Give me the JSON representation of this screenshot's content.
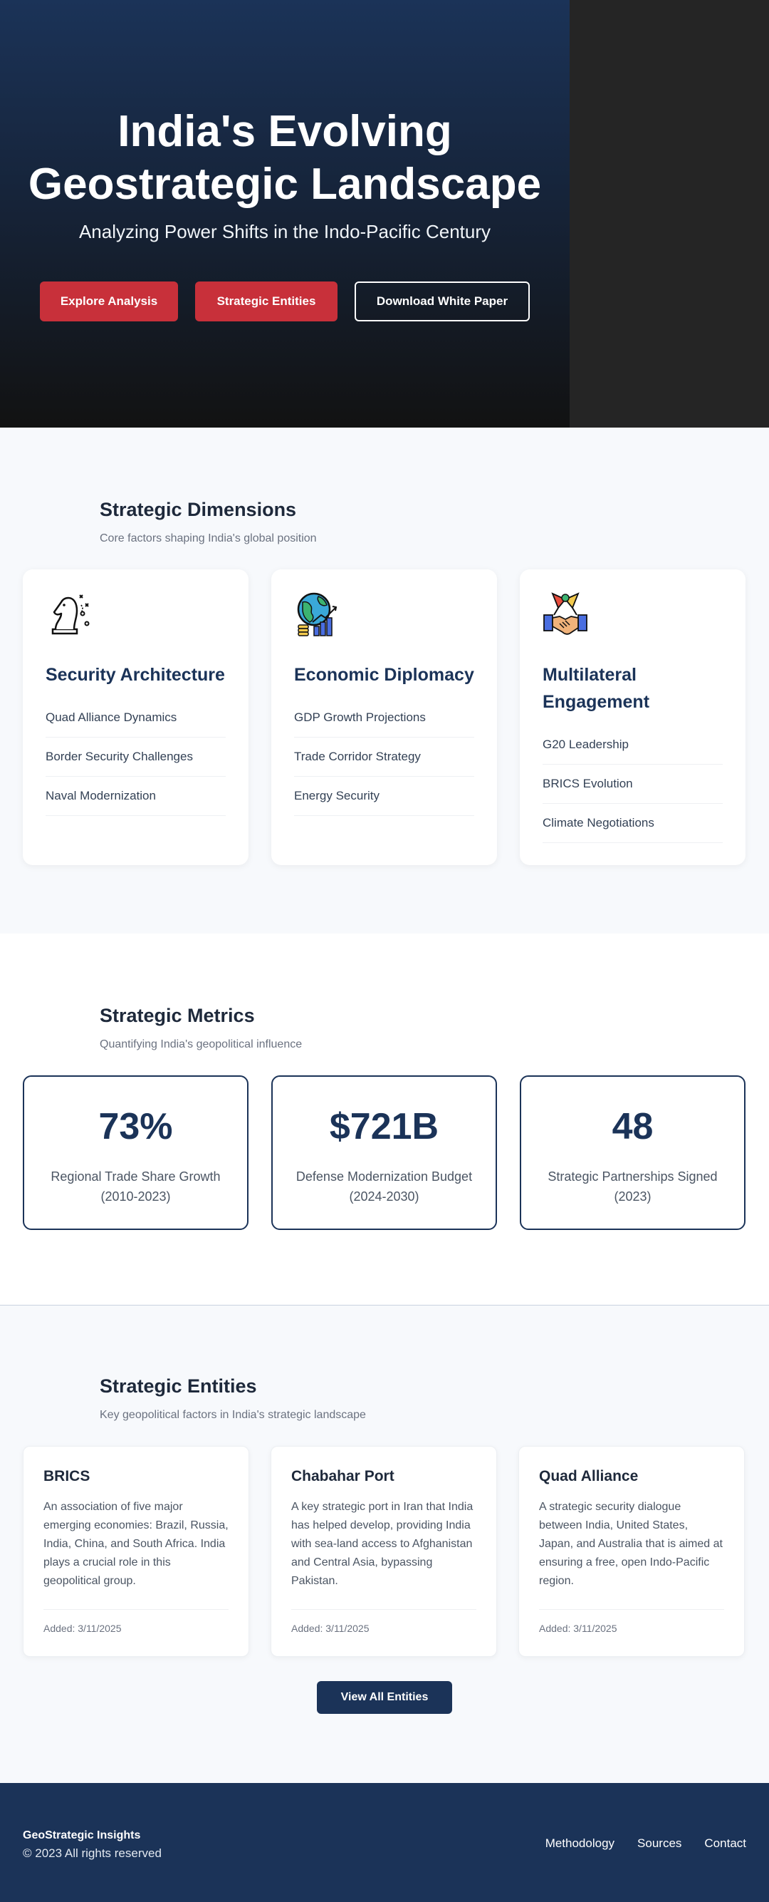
{
  "hero": {
    "title": "India's Evolving Geostrategic Landscape",
    "subtitle": "Analyzing Power Shifts in the Indo-Pacific Century",
    "buttons": [
      "Explore Analysis",
      "Strategic Entities",
      "Download White Paper"
    ]
  },
  "dimensions": {
    "title": "Strategic Dimensions",
    "subtitle": "Core factors shaping India's global position",
    "cards": [
      {
        "icon": "chess-knight-icon",
        "title": "Security Architecture",
        "items": [
          "Quad Alliance Dynamics",
          "Border Security Challenges",
          "Naval Modernization"
        ]
      },
      {
        "icon": "globe-growth-icon",
        "title": "Economic Diplomacy",
        "items": [
          "GDP Growth Projections",
          "Trade Corridor Strategy",
          "Energy Security"
        ]
      },
      {
        "icon": "handshake-flags-icon",
        "title": "Multilateral Engagement",
        "items": [
          "G20 Leadership",
          "BRICS Evolution",
          "Climate Negotiations"
        ]
      }
    ]
  },
  "metrics": {
    "title": "Strategic Metrics",
    "subtitle": "Quantifying India's geopolitical influence",
    "cards": [
      {
        "value": "73%",
        "label": "Regional Trade Share Growth (2010-2023)"
      },
      {
        "value": "$721B",
        "label": "Defense Modernization Budget (2024-2030)"
      },
      {
        "value": "48",
        "label": "Strategic Partnerships Signed (2023)"
      }
    ]
  },
  "entities": {
    "title": "Strategic Entities",
    "subtitle": "Key geopolitical factors in India's strategic landscape",
    "cards": [
      {
        "title": "BRICS",
        "description": "An association of five major emerging economies: Brazil, Russia, India, China, and South Africa. India plays a crucial role in this geopolitical group.",
        "added": "Added: 3/11/2025"
      },
      {
        "title": "Chabahar Port",
        "description": "A key strategic port in Iran that India has helped develop, providing India with sea-land access to Afghanistan and Central Asia, bypassing Pakistan.",
        "added": "Added: 3/11/2025"
      },
      {
        "title": "Quad Alliance",
        "description": "A strategic security dialogue between India, United States, Japan, and Australia that is aimed at ensuring a free, open Indo-Pacific region.",
        "added": "Added: 3/11/2025"
      }
    ],
    "view_all": "View All Entities"
  },
  "footer": {
    "brand": "GeoStrategic Insights",
    "copyright": "© 2023 All rights reserved",
    "links": [
      "Methodology",
      "Sources",
      "Contact"
    ]
  },
  "colors": {
    "navy": "#1b3358",
    "accent_red": "#c8303a",
    "bg": "#f7f9fc"
  }
}
